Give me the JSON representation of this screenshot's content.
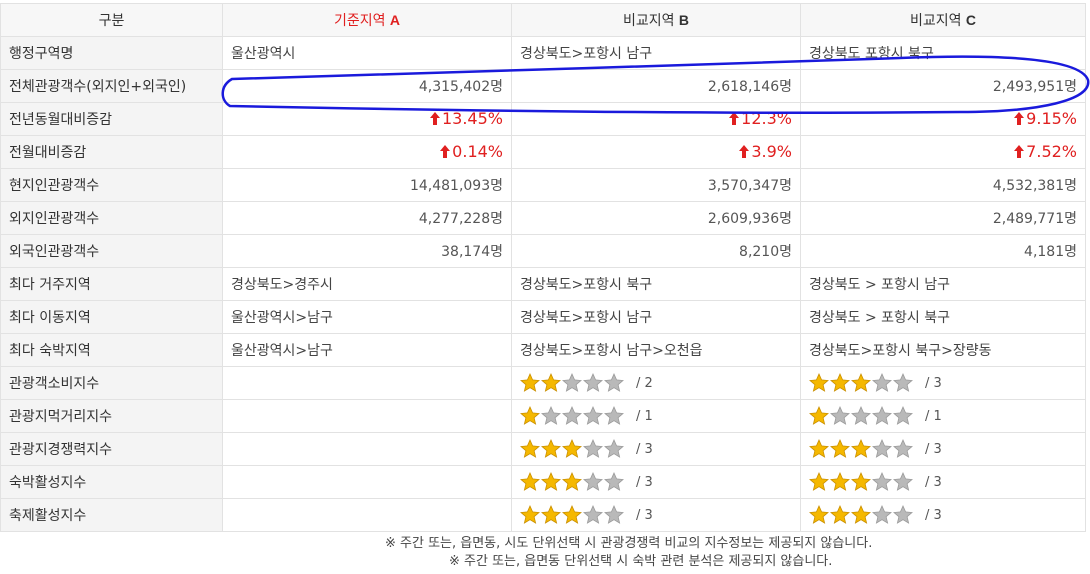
{
  "header": {
    "col0": "구분",
    "col1_prefix": "기준지역 ",
    "col1_letter": "A",
    "col2_prefix": "비교지역 ",
    "col2_letter": "B",
    "col3_prefix": "비교지역 ",
    "col3_letter": "C"
  },
  "rows": {
    "admin": {
      "label": "행정구역명",
      "a": "울산광역시",
      "b": "경상북도>포항시 남구",
      "c": "경상북도 포항시 북구"
    },
    "total": {
      "label": "전체관광객수(외지인+외국인)",
      "a": "4,315,402명",
      "b": "2,618,146명",
      "c": "2,493,951명"
    },
    "yoy": {
      "label": "전년동월대비증감",
      "a": "13.45%",
      "b": "12.3%",
      "c": "9.15%"
    },
    "mom": {
      "label": "전월대비증감",
      "a": "0.14%",
      "b": "3.9%",
      "c": "7.52%"
    },
    "local": {
      "label": "현지인관광객수",
      "a": "14,481,093명",
      "b": "3,570,347명",
      "c": "4,532,381명"
    },
    "outside": {
      "label": "외지인관광객수",
      "a": "4,277,228명",
      "b": "2,609,936명",
      "c": "2,489,771명"
    },
    "foreign": {
      "label": "외국인관광객수",
      "a": "38,174명",
      "b": "8,210명",
      "c": "4,181명"
    },
    "residence": {
      "label": "최다 거주지역",
      "a": "경상북도>경주시",
      "b": "경상북도>포항시 북구",
      "c": "경상북도 > 포항시 남구"
    },
    "movement": {
      "label": "최다 이동지역",
      "a": "울산광역시>남구",
      "b": "경상북도>포항시 남구",
      "c": "경상북도 > 포항시 북구"
    },
    "stay": {
      "label": "최다 숙박지역",
      "a": "울산광역시>남구",
      "b": "경상북도>포항시 남구>오천읍",
      "c": "경상북도>포항시 북구>장량동"
    }
  },
  "indices": [
    {
      "label": "관광객소비지수",
      "b": 2,
      "b_text": "/ 2",
      "c": 3,
      "c_text": "/ 3"
    },
    {
      "label": "관광지먹거리지수",
      "b": 1,
      "b_text": "/ 1",
      "c": 1,
      "c_text": "/ 1"
    },
    {
      "label": "관광지경쟁력지수",
      "b": 3,
      "b_text": "/ 3",
      "c": 3,
      "c_text": "/ 3"
    },
    {
      "label": "숙박활성지수",
      "b": 3,
      "b_text": "/ 3",
      "c": 3,
      "c_text": "/ 3"
    },
    {
      "label": "축제활성지수",
      "b": 3,
      "b_text": "/ 3",
      "c": 3,
      "c_text": "/ 3"
    }
  ],
  "stars_max": 5,
  "notes": {
    "line1": "※ 주간 또는, 읍면동, 시도 단위선택 시 관광경쟁력 비교의 지수정보는 제공되지 않습니다.",
    "line2": "※ 주간 또는, 읍면동 단위선택 시 숙박 관련 분석은 제공되지 않습니다."
  },
  "colors": {
    "accent_red": "#e02020",
    "star_gold": "#f5b800",
    "star_gray": "#b9b9b9",
    "annotation_blue": "#1a1adc"
  }
}
